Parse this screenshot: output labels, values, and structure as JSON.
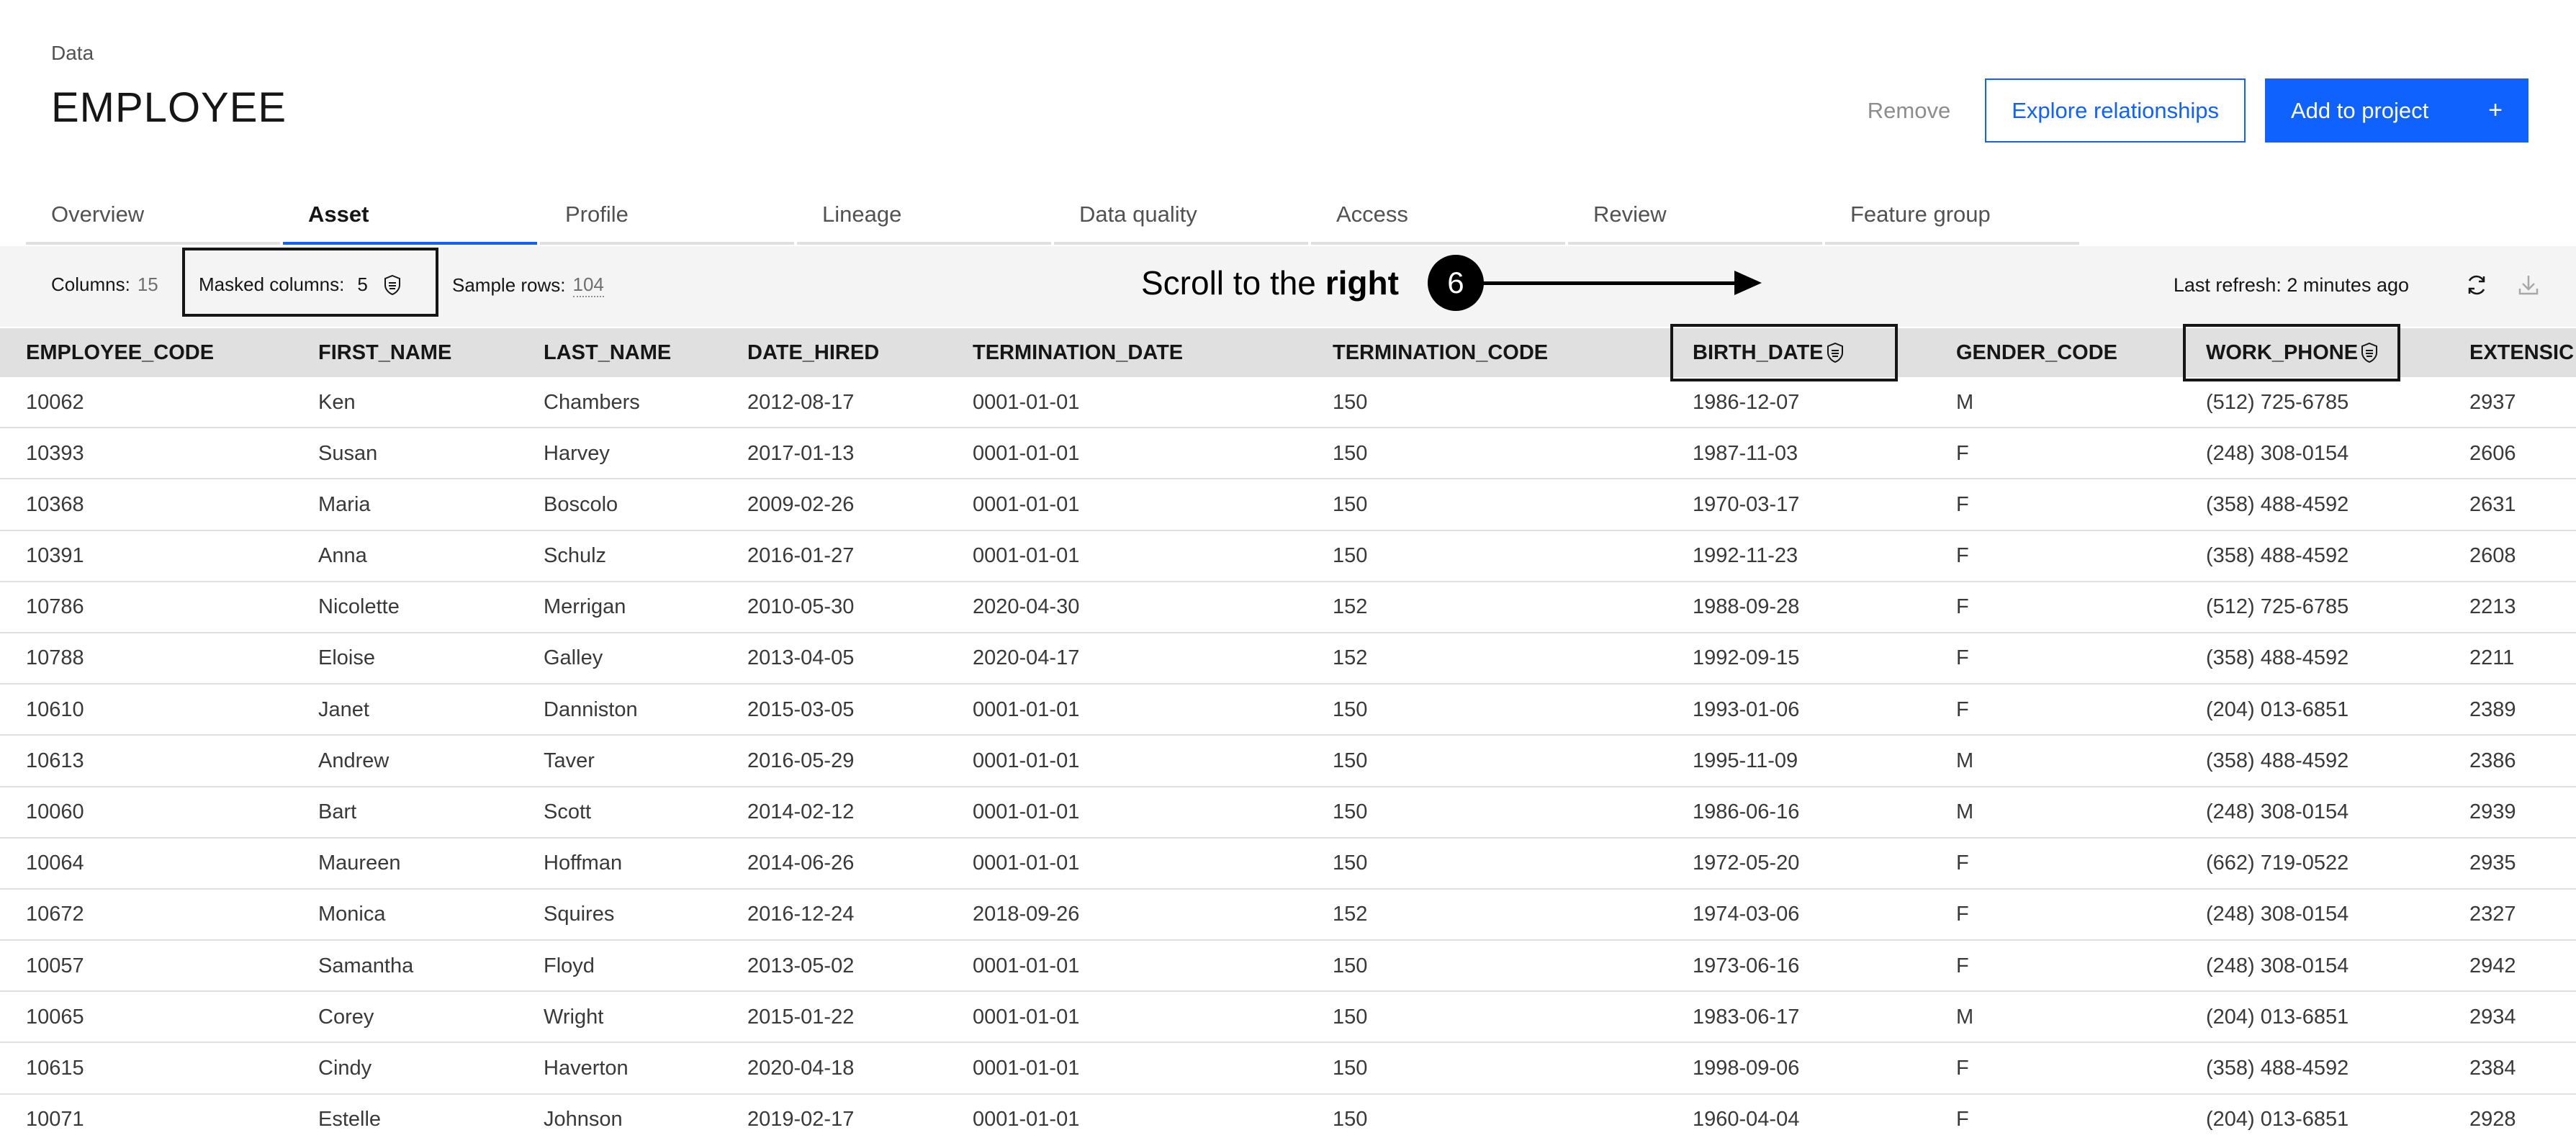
{
  "breadcrumb": "Data",
  "page_title": "EMPLOYEE",
  "actions": {
    "remove": "Remove",
    "explore": "Explore relationships",
    "add": "Add to project",
    "add_icon": "+"
  },
  "tabs": [
    "Overview",
    "Asset",
    "Profile",
    "Lineage",
    "Data quality",
    "Access",
    "Review",
    "Feature group"
  ],
  "active_tab": "Asset",
  "toolbar": {
    "columns_label": "Columns:",
    "columns_value": "15",
    "masked_label": "Masked columns:",
    "masked_value": "5",
    "sample_label": "Sample rows:",
    "sample_value": "104",
    "last_refresh": "Last refresh: 2 minutes ago"
  },
  "annotation": {
    "text_prefix": "Scroll to the ",
    "text_bold": "right",
    "step": "6"
  },
  "table": {
    "columns": [
      "EMPLOYEE_CODE",
      "FIRST_NAME",
      "LAST_NAME",
      "DATE_HIRED",
      "TERMINATION_DATE",
      "TERMINATION_CODE",
      "BIRTH_DATE",
      "GENDER_CODE",
      "WORK_PHONE",
      "EXTENSIC"
    ],
    "masked_columns": [
      "BIRTH_DATE",
      "WORK_PHONE"
    ],
    "rows": [
      [
        "10062",
        "Ken",
        "Chambers",
        "2012-08-17",
        "0001-01-01",
        "150",
        "1986-12-07",
        "M",
        "(512) 725-6785",
        "2937"
      ],
      [
        "10393",
        "Susan",
        "Harvey",
        "2017-01-13",
        "0001-01-01",
        "150",
        "1987-11-03",
        "F",
        "(248) 308-0154",
        "2606"
      ],
      [
        "10368",
        "Maria",
        "Boscolo",
        "2009-02-26",
        "0001-01-01",
        "150",
        "1970-03-17",
        "F",
        "(358) 488-4592",
        "2631"
      ],
      [
        "10391",
        "Anna",
        "Schulz",
        "2016-01-27",
        "0001-01-01",
        "150",
        "1992-11-23",
        "F",
        "(358) 488-4592",
        "2608"
      ],
      [
        "10786",
        "Nicolette",
        "Merrigan",
        "2010-05-30",
        "2020-04-30",
        "152",
        "1988-09-28",
        "F",
        "(512) 725-6785",
        "2213"
      ],
      [
        "10788",
        "Eloise",
        "Galley",
        "2013-04-05",
        "2020-04-17",
        "152",
        "1992-09-15",
        "F",
        "(358) 488-4592",
        "2211"
      ],
      [
        "10610",
        "Janet",
        "Danniston",
        "2015-03-05",
        "0001-01-01",
        "150",
        "1993-01-06",
        "F",
        "(204) 013-6851",
        "2389"
      ],
      [
        "10613",
        "Andrew",
        "Taver",
        "2016-05-29",
        "0001-01-01",
        "150",
        "1995-11-09",
        "M",
        "(358) 488-4592",
        "2386"
      ],
      [
        "10060",
        "Bart",
        "Scott",
        "2014-02-12",
        "0001-01-01",
        "150",
        "1986-06-16",
        "M",
        "(248) 308-0154",
        "2939"
      ],
      [
        "10064",
        "Maureen",
        "Hoffman",
        "2014-06-26",
        "0001-01-01",
        "150",
        "1972-05-20",
        "F",
        "(662) 719-0522",
        "2935"
      ],
      [
        "10672",
        "Monica",
        "Squires",
        "2016-12-24",
        "2018-09-26",
        "152",
        "1974-03-06",
        "F",
        "(248) 308-0154",
        "2327"
      ],
      [
        "10057",
        "Samantha",
        "Floyd",
        "2013-05-02",
        "0001-01-01",
        "150",
        "1973-06-16",
        "F",
        "(248) 308-0154",
        "2942"
      ],
      [
        "10065",
        "Corey",
        "Wright",
        "2015-01-22",
        "0001-01-01",
        "150",
        "1983-06-17",
        "M",
        "(204) 013-6851",
        "2934"
      ],
      [
        "10615",
        "Cindy",
        "Haverton",
        "2020-04-18",
        "0001-01-01",
        "150",
        "1998-09-06",
        "F",
        "(358) 488-4592",
        "2384"
      ],
      [
        "10071",
        "Estelle",
        "Johnson",
        "2019-02-17",
        "0001-01-01",
        "150",
        "1960-04-04",
        "F",
        "(204) 013-6851",
        "2928"
      ]
    ]
  },
  "colors": {
    "accent": "#0f62fe",
    "toolbar_bg": "#f4f4f4",
    "header_bg": "#e0e0e0"
  },
  "icons": {
    "masked": "shield-icon",
    "refresh": "refresh-icon",
    "download": "download-icon"
  }
}
